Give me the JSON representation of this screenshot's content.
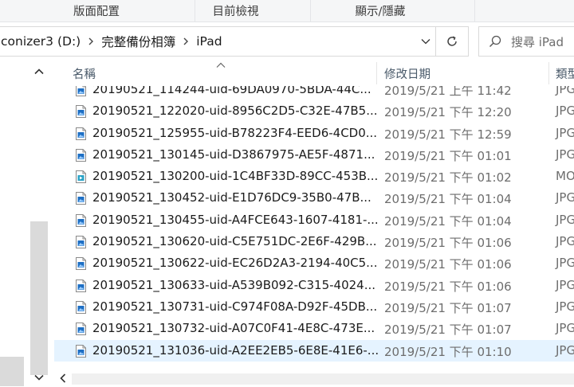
{
  "ribbon": {
    "groups": [
      {
        "label": "版面配置"
      },
      {
        "label": "目前檢視"
      },
      {
        "label": "顯示/隱藏"
      }
    ]
  },
  "address": {
    "crumbs": [
      "conizer3 (D:)",
      "完整備份相簿",
      "iPad"
    ],
    "search_placeholder": "搜尋 iPad"
  },
  "columns": {
    "name": "名稱",
    "date": "修改日期",
    "type": "類型"
  },
  "files": [
    {
      "name": "20190521_114244-uid-69DA0970-5BDA-44C...",
      "date": "2019/5/21 上午 11:42",
      "type": "JPG",
      "icon": "image-file-icon"
    },
    {
      "name": "20190521_122020-uid-8956C2D5-C32E-47B5...",
      "date": "2019/5/21 下午 12:20",
      "type": "JPG",
      "icon": "image-file-icon"
    },
    {
      "name": "20190521_125955-uid-B78223F4-EED6-4CD0...",
      "date": "2019/5/21 下午 12:59",
      "type": "JPG",
      "icon": "image-file-icon"
    },
    {
      "name": "20190521_130145-uid-D3867975-AE5F-4871...",
      "date": "2019/5/21 下午 01:01",
      "type": "JPG",
      "icon": "image-file-icon"
    },
    {
      "name": "20190521_130200-uid-1C4BF33D-89CC-453B...",
      "date": "2019/5/21 下午 01:02",
      "type": "MO",
      "icon": "video-file-icon"
    },
    {
      "name": "20190521_130452-uid-E1D76DC9-35B0-47B...",
      "date": "2019/5/21 下午 01:04",
      "type": "JPG",
      "icon": "image-file-icon"
    },
    {
      "name": "20190521_130455-uid-A4FCE643-1607-4181-...",
      "date": "2019/5/21 下午 01:04",
      "type": "JPG",
      "icon": "image-file-icon"
    },
    {
      "name": "20190521_130620-uid-C5E751DC-2E6F-429B...",
      "date": "2019/5/21 下午 01:06",
      "type": "JPG",
      "icon": "image-file-icon"
    },
    {
      "name": "20190521_130622-uid-EC26D2A3-2194-40C5...",
      "date": "2019/5/21 下午 01:06",
      "type": "JPG",
      "icon": "image-file-icon"
    },
    {
      "name": "20190521_130633-uid-A539B092-C315-4024...",
      "date": "2019/5/21 下午 01:06",
      "type": "JPG",
      "icon": "image-file-icon"
    },
    {
      "name": "20190521_130731-uid-C974F08A-D92F-45DB...",
      "date": "2019/5/21 下午 01:07",
      "type": "JPG",
      "icon": "image-file-icon"
    },
    {
      "name": "20190521_130732-uid-A07C0F41-4E8C-473E...",
      "date": "2019/5/21 下午 01:07",
      "type": "JPG",
      "icon": "image-file-icon"
    },
    {
      "name": "20190521_131036-uid-A2EE2EB5-6E8E-41E6-...",
      "date": "2019/5/21 下午 01:10",
      "type": "JPG",
      "icon": "image-file-icon",
      "selected": true
    }
  ],
  "colors": {
    "selection": "#e5f3ff",
    "icon_blue": "#1e6fc4"
  }
}
